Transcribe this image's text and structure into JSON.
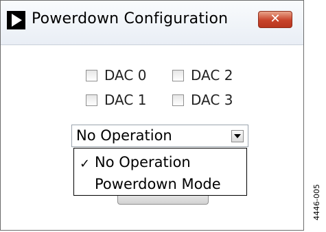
{
  "window": {
    "title": "Powerdown Configuration",
    "close_glyph": "✕"
  },
  "checkboxes": [
    {
      "label": "DAC 0",
      "checked": false
    },
    {
      "label": "DAC 2",
      "checked": false
    },
    {
      "label": "DAC 1",
      "checked": false
    },
    {
      "label": "DAC 3",
      "checked": false
    }
  ],
  "mode_select": {
    "value": "No Operation",
    "options": [
      {
        "label": "No Operation",
        "selected": true,
        "check": "✓"
      },
      {
        "label": "Powerdown Mode",
        "selected": false,
        "check": ""
      }
    ]
  },
  "figure_id": "4446-005",
  "colors": {
    "close_button": "#c8432a",
    "titlebar": "#e9eef5"
  }
}
